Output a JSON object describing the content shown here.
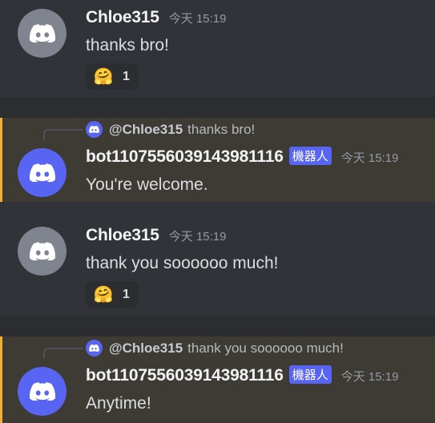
{
  "messages": [
    {
      "author": "Chloe315",
      "timestamp": "今天 15:19",
      "content": "thanks bro!",
      "avatar_icon": "discord-logo-icon",
      "reaction": {
        "emoji": "🤗",
        "count": "1"
      }
    },
    {
      "reply": {
        "mention": "@Chloe315",
        "text": "thanks bro!"
      },
      "author": "bot1107556039143981116",
      "bot_tag": "機器人",
      "timestamp": "今天 15:19",
      "content": "You're welcome.",
      "avatar_icon": "discord-logo-icon"
    },
    {
      "author": "Chloe315",
      "timestamp": "今天 15:19",
      "content": "thank you soooooo much!",
      "avatar_icon": "discord-logo-icon",
      "reaction": {
        "emoji": "🤗",
        "count": "1"
      }
    },
    {
      "reply": {
        "mention": "@Chloe315",
        "text": "thank you soooooo much!"
      },
      "author": "bot1107556039143981116",
      "bot_tag": "機器人",
      "timestamp": "今天 15:19",
      "content": "Anytime!",
      "avatar_icon": "discord-logo-icon"
    }
  ],
  "colors": {
    "background": "#313338",
    "highlight_background": "#3d3b33",
    "highlight_border": "#f0b132",
    "bot_avatar": "#5865f2",
    "user_avatar": "#80848e",
    "bot_tag": "#5865f2"
  }
}
